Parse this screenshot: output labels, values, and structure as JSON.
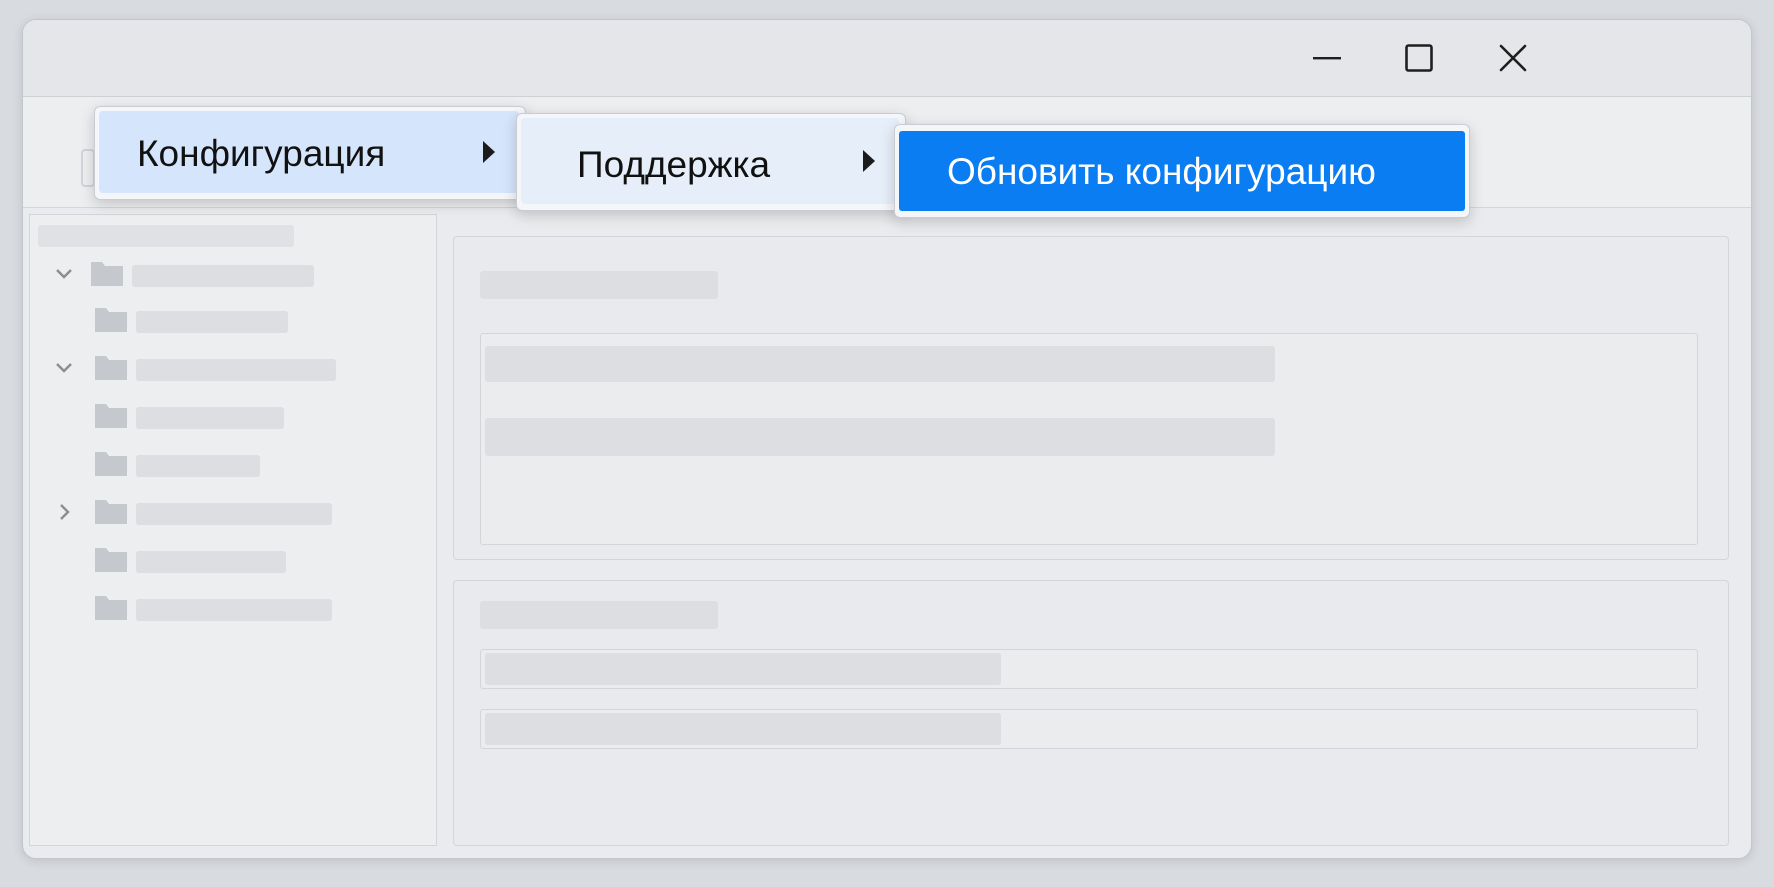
{
  "colors": {
    "window_bg": "#e9ebee",
    "menu_bg": "#f4f6f9",
    "menu_hover_bg": "#d5e5fb",
    "submenu_hover_bg": "#e6eef9",
    "accent_selected": "#0a7df2",
    "selected_text": "#ffffff",
    "skeleton": "#dcdee1"
  },
  "window_controls": {
    "minimize_icon": "minimize-icon",
    "maximize_icon": "maximize-icon",
    "close_icon": "close-icon"
  },
  "menu": {
    "level1": {
      "label": "Конфигурация",
      "has_submenu": true
    },
    "level2": {
      "label": "Поддержка",
      "has_submenu": true
    },
    "level3": {
      "label": "Обновить конфигурацию",
      "selected": true
    }
  },
  "sidebar": {
    "tree": [
      {
        "expander": "expanded",
        "indent": 0
      },
      {
        "expander": "none",
        "indent": 1
      },
      {
        "expander": "expanded",
        "indent": 0
      },
      {
        "expander": "none",
        "indent": 1
      },
      {
        "expander": "none",
        "indent": 1
      },
      {
        "expander": "collapsed",
        "indent": 0
      },
      {
        "expander": "none",
        "indent": 1
      },
      {
        "expander": "none",
        "indent": 1
      }
    ]
  }
}
